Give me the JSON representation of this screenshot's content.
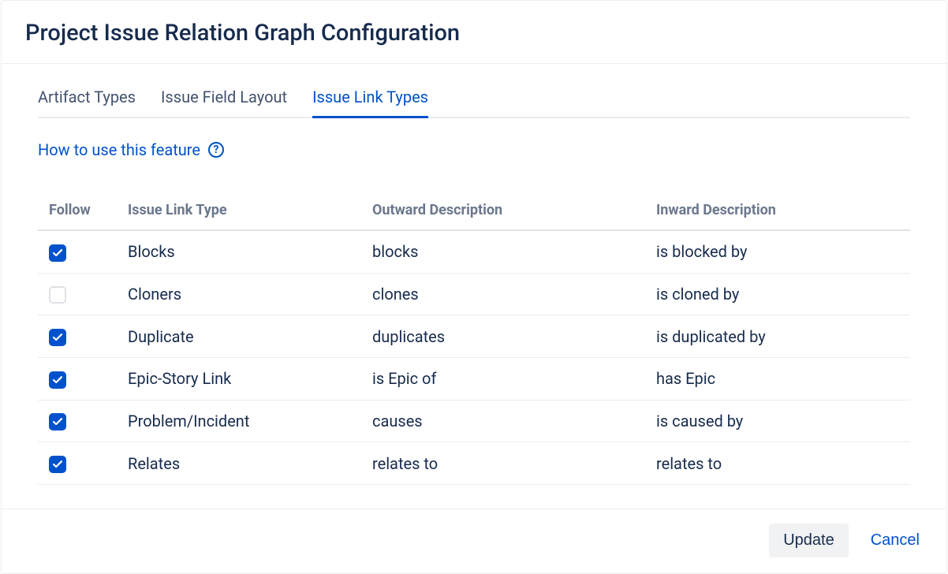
{
  "dialog": {
    "title": "Project Issue Relation Graph Configuration"
  },
  "tabs": [
    {
      "id": "artifact-types",
      "label": "Artifact Types",
      "active": false
    },
    {
      "id": "issue-field-layout",
      "label": "Issue Field Layout",
      "active": false
    },
    {
      "id": "issue-link-types",
      "label": "Issue Link Types",
      "active": true
    }
  ],
  "help": {
    "label": "How to use this feature"
  },
  "table": {
    "columns": {
      "follow": "Follow",
      "type": "Issue Link Type",
      "outward": "Outward Description",
      "inward": "Inward Description"
    },
    "rows": [
      {
        "follow": true,
        "type": "Blocks",
        "outward": "blocks",
        "inward": "is blocked by"
      },
      {
        "follow": false,
        "type": "Cloners",
        "outward": "clones",
        "inward": "is cloned by"
      },
      {
        "follow": true,
        "type": "Duplicate",
        "outward": "duplicates",
        "inward": "is duplicated by"
      },
      {
        "follow": true,
        "type": "Epic-Story Link",
        "outward": "is Epic of",
        "inward": "has Epic"
      },
      {
        "follow": true,
        "type": "Problem/Incident",
        "outward": "causes",
        "inward": "is caused by"
      },
      {
        "follow": true,
        "type": "Relates",
        "outward": "relates to",
        "inward": "relates to"
      }
    ]
  },
  "footer": {
    "update": "Update",
    "cancel": "Cancel"
  }
}
